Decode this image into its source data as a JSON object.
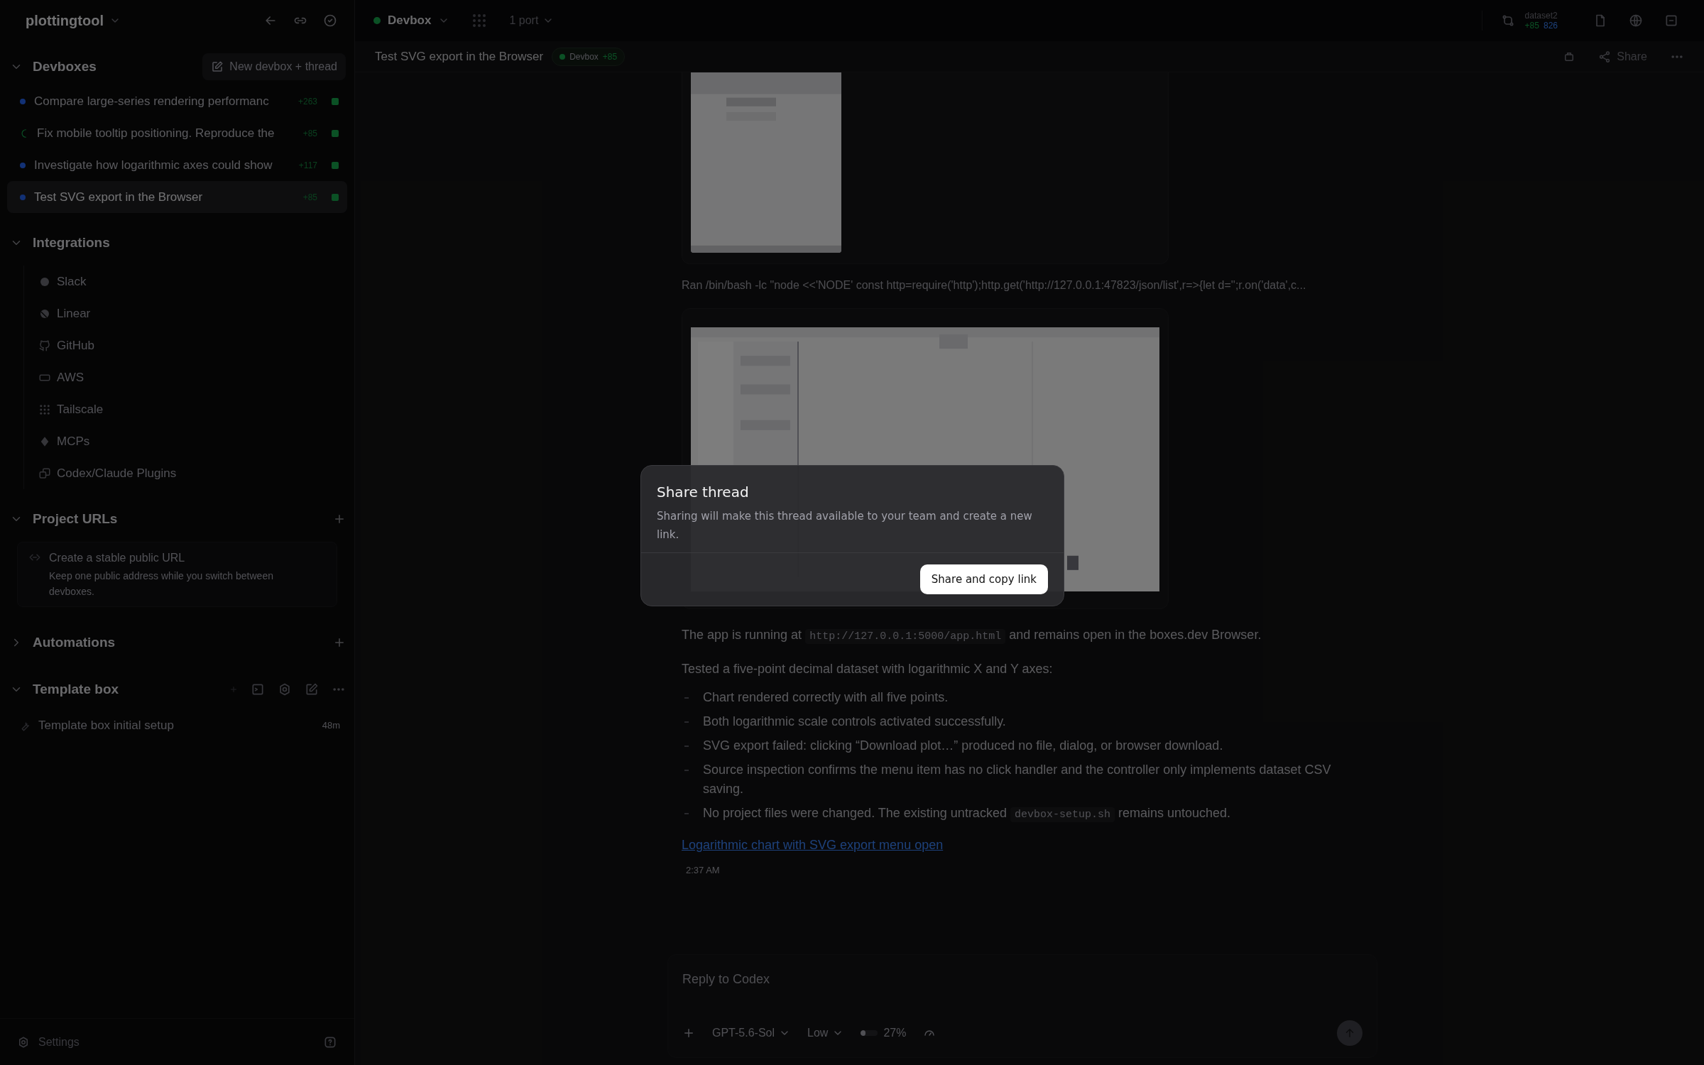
{
  "sidebar": {
    "project": "plottingtool",
    "devboxes": {
      "title": "Devboxes",
      "expanded": true,
      "new_button": "New devbox + thread",
      "items": [
        {
          "title": "Compare large-series rendering performanc",
          "kind": "dot",
          "diff": "+263",
          "selected": false
        },
        {
          "title": "Fix mobile tooltip positioning. Reproduce the",
          "kind": "spinner",
          "diff": "+85",
          "selected": false
        },
        {
          "title": "Investigate how logarithmic axes could show",
          "kind": "dot",
          "diff": "+117",
          "selected": false
        },
        {
          "title": "Test SVG export in the Browser",
          "kind": "dot",
          "diff": "+85",
          "selected": true
        }
      ]
    },
    "integrations": {
      "title": "Integrations",
      "expanded": true,
      "items": [
        {
          "label": "Slack",
          "kind": "slack"
        },
        {
          "label": "Linear",
          "kind": "linear"
        },
        {
          "label": "GitHub",
          "kind": "github"
        },
        {
          "label": "AWS",
          "kind": "aws"
        },
        {
          "label": "Tailscale",
          "kind": "tailscale"
        },
        {
          "label": "MCPs",
          "kind": "mcp"
        },
        {
          "label": "Codex/Claude Plugins",
          "kind": "plugins"
        }
      ]
    },
    "project_urls": {
      "title": "Project URLs",
      "expanded": true,
      "card_title": "Create a stable public URL",
      "card_text": "Keep one public address while you switch between devboxes."
    },
    "automations": {
      "title": "Automations",
      "expanded": false
    },
    "template_box": {
      "title": "Template box",
      "expanded": true,
      "items": [
        {
          "title": "Template box initial setup",
          "time": "48m"
        }
      ]
    },
    "settings": "Settings"
  },
  "topbar": {
    "devbox": "Devbox",
    "ports": "1 port",
    "branch": "dataset2",
    "added": "+85",
    "removed": "826"
  },
  "thread": {
    "title": "Test SVG export in the Browser",
    "badge": "Devbox",
    "badge_diff": "+85",
    "share": "Share"
  },
  "messages": {
    "command": "Ran /bin/bash -lc \"node <<'NODE' const http=require('http');http.get('http://127.0.0.1:47823/json/list',r=>{let d='';r.on('data',c...",
    "paragraphs": [
      [
        {
          "kind": "text",
          "text": "The app is running at "
        },
        {
          "kind": "code",
          "text": "http://127.0.0.1:5000/app.html"
        },
        {
          "kind": "text",
          "text": " and remains open in the boxes.dev Browser."
        }
      ],
      [
        {
          "kind": "text",
          "text": "Tested a five-point decimal dataset with logarithmic X and Y axes:"
        }
      ]
    ],
    "bullets": [
      [
        {
          "kind": "text",
          "text": "Chart rendered correctly with all five points."
        }
      ],
      [
        {
          "kind": "text",
          "text": "Both logarithmic scale controls activated successfully."
        }
      ],
      [
        {
          "kind": "text",
          "text": "SVG export failed: clicking “Download plot…” produced no file, dialog, or browser download."
        }
      ],
      [
        {
          "kind": "text",
          "text": "Source inspection confirms the menu item has no click handler and the controller only implements dataset CSV saving."
        }
      ],
      [
        {
          "kind": "text",
          "text": "No project files were changed. The existing untracked "
        },
        {
          "kind": "code",
          "text": "devbox-setup.sh"
        },
        {
          "kind": "text",
          "text": " remains untouched."
        }
      ]
    ],
    "link": "Logarithmic chart with SVG export menu open",
    "time": "2:37 AM"
  },
  "composer": {
    "placeholder": "Reply to Codex",
    "model": "GPT-5.6-Sol",
    "effort": "Low",
    "context": "27%",
    "level": 0.27
  },
  "dialog": {
    "title": "Share thread",
    "text": "Sharing will make this thread available to your team and create a new link.",
    "button": "Share and copy link"
  }
}
